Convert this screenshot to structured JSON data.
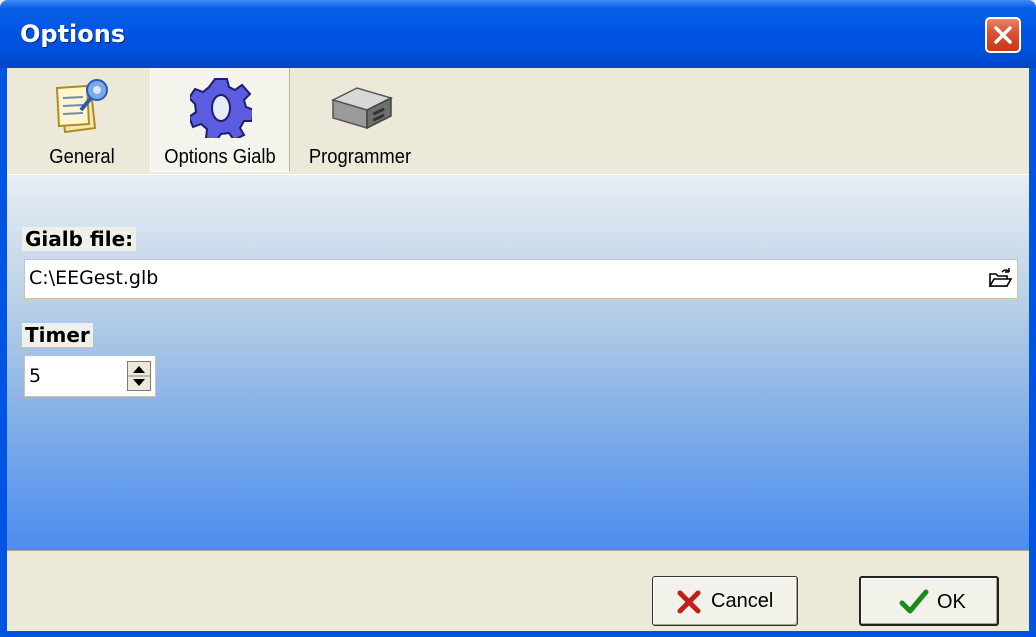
{
  "window": {
    "title": "Options"
  },
  "toolbar": {
    "items": [
      {
        "label": "General",
        "icon": "general-settings-icon"
      },
      {
        "label": "Options Gialb",
        "icon": "gear-icon",
        "selected": true
      },
      {
        "label": "Programmer",
        "icon": "programmer-device-icon"
      }
    ]
  },
  "form": {
    "gialb_file": {
      "label": "Gialb file:",
      "value": "C:\\EEGest.glb"
    },
    "timer": {
      "label": "Timer",
      "value": "5"
    }
  },
  "buttons": {
    "cancel": "Cancel",
    "ok": "OK"
  },
  "colors": {
    "title_bar": "#0054e3",
    "panel_top": "#e8eef5",
    "panel_bottom": "#4b8cf0",
    "close": "#d8502f"
  }
}
